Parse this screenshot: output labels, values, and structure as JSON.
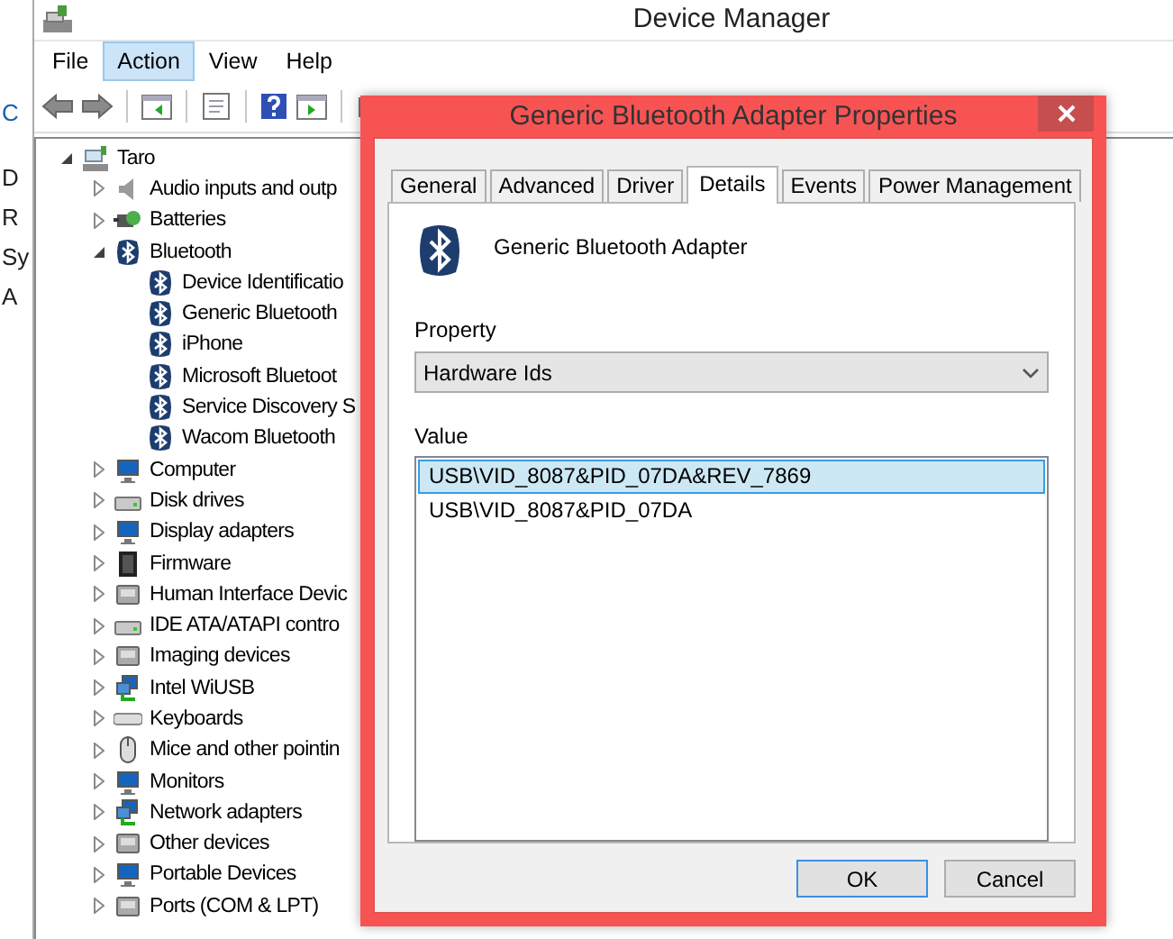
{
  "background_window": {
    "letters": [
      "C",
      "D",
      "R",
      "Sy",
      "A"
    ]
  },
  "window": {
    "title": "Device Manager"
  },
  "menu": [
    {
      "label": "File",
      "selected": false
    },
    {
      "label": "Action",
      "selected": true
    },
    {
      "label": "View",
      "selected": false
    },
    {
      "label": "Help",
      "selected": false
    }
  ],
  "tree": [
    {
      "label": "Taro",
      "kind": "computer",
      "expanded": true,
      "children": [
        {
          "label": "Audio inputs and outp",
          "kind": "speaker",
          "expanded": false
        },
        {
          "label": "Batteries",
          "kind": "battery",
          "expanded": false
        },
        {
          "label": "Bluetooth",
          "kind": "bluetooth",
          "expanded": true,
          "children": [
            {
              "label": "Device Identificatio",
              "kind": "bluetooth"
            },
            {
              "label": "Generic Bluetooth",
              "kind": "bluetooth"
            },
            {
              "label": "iPhone",
              "kind": "bluetooth"
            },
            {
              "label": "Microsoft Bluetoot",
              "kind": "bluetooth"
            },
            {
              "label": "Service Discovery S",
              "kind": "bluetooth"
            },
            {
              "label": "Wacom Bluetooth",
              "kind": "bluetooth"
            }
          ]
        },
        {
          "label": "Computer",
          "kind": "monitor",
          "expanded": false
        },
        {
          "label": "Disk drives",
          "kind": "drive",
          "expanded": false
        },
        {
          "label": "Display adapters",
          "kind": "monitor",
          "expanded": false
        },
        {
          "label": "Firmware",
          "kind": "chip",
          "expanded": false
        },
        {
          "label": "Human Interface Devic",
          "kind": "device",
          "expanded": false
        },
        {
          "label": "IDE ATA/ATAPI contro",
          "kind": "drive",
          "expanded": false
        },
        {
          "label": "Imaging devices",
          "kind": "device",
          "expanded": false
        },
        {
          "label": "Intel WiUSB",
          "kind": "network",
          "expanded": false
        },
        {
          "label": "Keyboards",
          "kind": "keyboard",
          "expanded": false
        },
        {
          "label": "Mice and other pointin",
          "kind": "mouse",
          "expanded": false
        },
        {
          "label": "Monitors",
          "kind": "monitor",
          "expanded": false
        },
        {
          "label": "Network adapters",
          "kind": "network",
          "expanded": false
        },
        {
          "label": "Other devices",
          "kind": "device",
          "expanded": false
        },
        {
          "label": "Portable Devices",
          "kind": "monitor",
          "expanded": false
        },
        {
          "label": "Ports (COM & LPT)",
          "kind": "device",
          "expanded": false
        }
      ]
    }
  ],
  "dialog": {
    "title": "Generic Bluetooth Adapter Properties",
    "tabs": [
      {
        "label": "General",
        "selected": false
      },
      {
        "label": "Advanced",
        "selected": false
      },
      {
        "label": "Driver",
        "selected": false
      },
      {
        "label": "Details",
        "selected": true
      },
      {
        "label": "Events",
        "selected": false
      },
      {
        "label": "Power Management",
        "selected": false
      }
    ],
    "device_name": "Generic Bluetooth Adapter",
    "property_label": "Property",
    "property": {
      "value": "Hardware Ids"
    },
    "value_label": "Value",
    "values": [
      {
        "text": "USB\\VID_8087&PID_07DA&REV_7869",
        "selected": true
      },
      {
        "text": "USB\\VID_8087&PID_07DA",
        "selected": false
      }
    ],
    "buttons": [
      {
        "label": "OK",
        "default": true
      },
      {
        "label": "Cancel",
        "default": false
      }
    ]
  }
}
